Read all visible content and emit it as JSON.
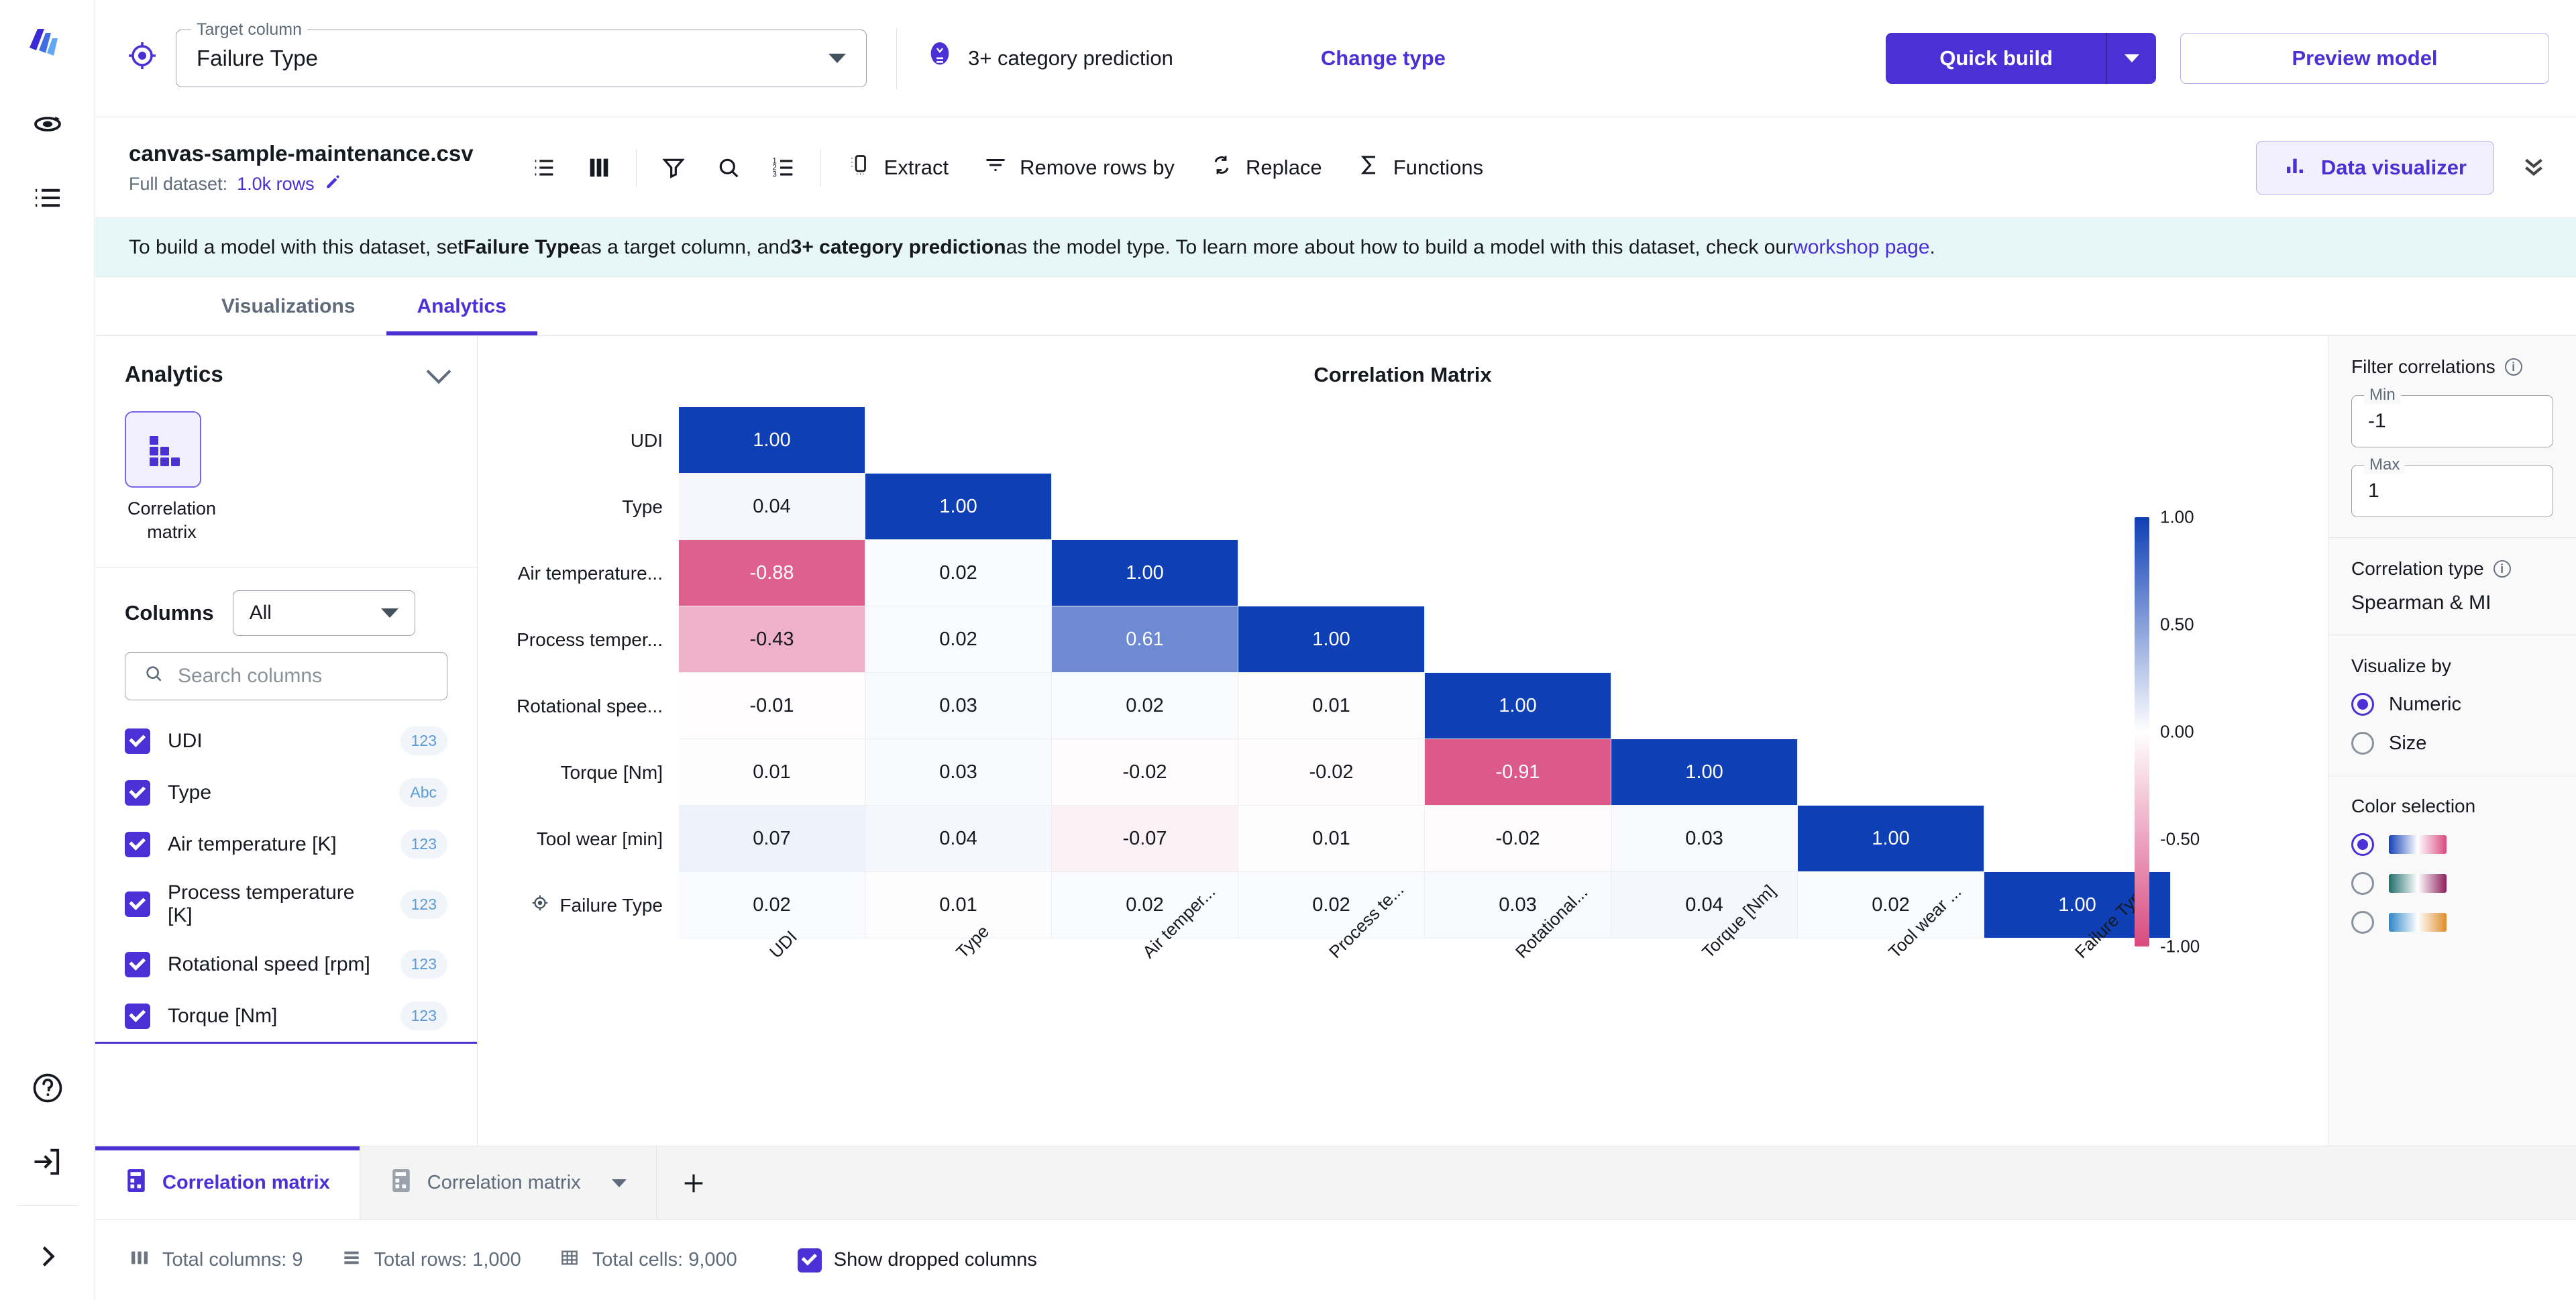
{
  "rail": {
    "items": [
      {
        "name": "app-logo-icon",
        "label": "SageMaker Canvas"
      },
      {
        "name": "models-icon",
        "label": "My models"
      },
      {
        "name": "datasets-icon",
        "label": "Datasets"
      },
      {
        "name": "help-icon",
        "label": "Help"
      },
      {
        "name": "signout-icon",
        "label": "Sign out"
      },
      {
        "name": "expand-rail-icon",
        "label": "Expand"
      }
    ]
  },
  "topbar": {
    "target_legend": "Target column",
    "target_value": "Failure Type",
    "prediction_type": "3+ category prediction",
    "change_type": "Change type",
    "quick_build": "Quick build",
    "preview_model": "Preview model"
  },
  "dataset_toolbar": {
    "name": "canvas-sample-maintenance.csv",
    "full_dataset_label": "Full dataset:",
    "rows": "1.0k rows",
    "icon_buttons": [
      "list-view-icon",
      "column-view-icon",
      "filter-icon",
      "search-icon",
      "numbered-list-icon"
    ],
    "actions": [
      {
        "icon": "extract-icon",
        "label": "Extract"
      },
      {
        "icon": "remove-rows-icon",
        "label": "Remove rows by"
      },
      {
        "icon": "replace-icon",
        "label": "Replace"
      },
      {
        "icon": "functions-icon",
        "label": "Functions"
      }
    ],
    "data_visualizer": "Data visualizer"
  },
  "banner": {
    "part1": "To build a model with this dataset, set ",
    "bold1": "Failure Type",
    "part2": " as a target column, and ",
    "bold2": "3+ category prediction",
    "part3": " as the model type. To learn more about how to build a model with this dataset, check our ",
    "link": "workshop page",
    "part4": "."
  },
  "tabs": [
    {
      "label": "Visualizations",
      "active": false
    },
    {
      "label": "Analytics",
      "active": true
    }
  ],
  "left_panel": {
    "section_title": "Analytics",
    "viz_tile_label": "Correlation matrix",
    "columns_title": "Columns",
    "columns_filter_value": "All",
    "search_placeholder": "Search columns",
    "columns": [
      {
        "label": "UDI",
        "type": "123",
        "checked": true
      },
      {
        "label": "Type",
        "type": "Abc",
        "checked": true
      },
      {
        "label": "Air temperature [K]",
        "type": "123",
        "checked": true
      },
      {
        "label": "Process temperature [K]",
        "type": "123",
        "checked": true
      },
      {
        "label": "Rotational speed [rpm]",
        "type": "123",
        "checked": true
      },
      {
        "label": "Torque [Nm]",
        "type": "123",
        "checked": true
      }
    ]
  },
  "right_panel": {
    "filter_title": "Filter correlations",
    "min_legend": "Min",
    "min_value": "-1",
    "max_legend": "Max",
    "max_value": "1",
    "corr_type_title": "Correlation type",
    "corr_type_value": "Spearman & MI",
    "visualize_by_title": "Visualize by",
    "visualize_options": [
      {
        "label": "Numeric",
        "selected": true
      },
      {
        "label": "Size",
        "selected": false
      }
    ],
    "color_selection_title": "Color selection",
    "color_options": [
      {
        "selected": true,
        "from": "#1542b8",
        "mid": "#ffffff",
        "to": "#d94a7e"
      },
      {
        "selected": false,
        "from": "#1f6f6b",
        "mid": "#ffffff",
        "to": "#8e1f5e"
      },
      {
        "selected": false,
        "from": "#2d86c8",
        "mid": "#ffffff",
        "to": "#e08c2a"
      }
    ]
  },
  "bottom_tabs": [
    {
      "label": "Correlation matrix",
      "active": true,
      "icon": "matrix-icon"
    },
    {
      "label": "Correlation matrix",
      "active": false,
      "icon": "matrix-icon"
    }
  ],
  "bottom_add_label": "+",
  "statusbar": {
    "total_columns": "Total columns: 9",
    "total_rows": "Total rows: 1,000",
    "total_cells": "Total cells: 9,000",
    "show_dropped": "Show dropped columns"
  },
  "chart_data": {
    "type": "heatmap",
    "title": "Correlation Matrix",
    "xlabel": "",
    "ylabel": "",
    "grid": true,
    "legend_position": "right",
    "colorbar": {
      "ticks": [
        "1.00",
        "0.50",
        "0.00",
        "-0.50",
        "-1.00"
      ],
      "vmin": -1,
      "vmax": 1,
      "low_color": "#d94a7e",
      "mid_color": "#ffffff",
      "high_color": "#0f3fb5"
    },
    "row_labels": [
      "UDI",
      "Type",
      "Air temperature...",
      "Process temper...",
      "Rotational spee...",
      "Torque [Nm]",
      "Tool wear [min]",
      "Failure Type"
    ],
    "row_labels_full": [
      "UDI",
      "Type",
      "Air temperature [K]",
      "Process temperature [K]",
      "Rotational speed [rpm]",
      "Torque [Nm]",
      "Tool wear [min]",
      "Failure Type"
    ],
    "col_labels": [
      "UDI",
      "Type",
      "Air temper...",
      "Process te...",
      "Rotational...",
      "Torque [Nm]",
      "Tool wear ...",
      "Failure Type"
    ],
    "target_row_index": 7,
    "values": [
      [
        1.0,
        null,
        null,
        null,
        null,
        null,
        null,
        null
      ],
      [
        0.04,
        1.0,
        null,
        null,
        null,
        null,
        null,
        null
      ],
      [
        -0.88,
        0.02,
        1.0,
        null,
        null,
        null,
        null,
        null
      ],
      [
        -0.43,
        0.02,
        0.61,
        1.0,
        null,
        null,
        null,
        null
      ],
      [
        -0.01,
        0.03,
        0.02,
        0.01,
        1.0,
        null,
        null,
        null
      ],
      [
        0.01,
        0.03,
        -0.02,
        -0.02,
        -0.91,
        1.0,
        null,
        null
      ],
      [
        0.07,
        0.04,
        -0.07,
        0.01,
        -0.02,
        0.03,
        1.0,
        null
      ],
      [
        0.02,
        0.01,
        0.02,
        0.02,
        0.03,
        0.04,
        0.02,
        1.0
      ]
    ],
    "value_labels": [
      [
        "1.00",
        "",
        "",
        "",
        "",
        "",
        "",
        ""
      ],
      [
        "0.04",
        "1.00",
        "",
        "",
        "",
        "",
        "",
        ""
      ],
      [
        "-0.88",
        "0.02",
        "1.00",
        "",
        "",
        "",
        "",
        ""
      ],
      [
        "-0.43",
        "0.02",
        "0.61",
        "1.00",
        "",
        "",
        "",
        ""
      ],
      [
        "-0.01",
        "0.03",
        "0.02",
        "0.01",
        "1.00",
        "",
        "",
        ""
      ],
      [
        "0.01",
        "0.03",
        "-0.02",
        "-0.02",
        "-0.91",
        "1.00",
        "",
        ""
      ],
      [
        "0.07",
        "0.04",
        "-0.07",
        "0.01",
        "-0.02",
        "0.03",
        "1.00",
        ""
      ],
      [
        "0.02",
        "0.01",
        "0.02",
        "0.02",
        "0.03",
        "0.04",
        "0.02",
        "1.00"
      ]
    ]
  }
}
